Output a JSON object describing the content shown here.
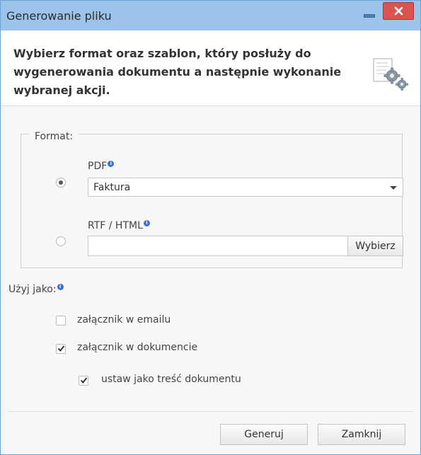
{
  "window": {
    "title": "Generowanie pliku"
  },
  "header": {
    "text": "Wybierz format oraz szablon, który posłuży do wygenerowania dokumentu a następnie wykonanie wybranej akcji."
  },
  "format": {
    "legend": "Format:",
    "pdf": {
      "label": "PDF",
      "selected": true,
      "template": "Faktura"
    },
    "rtf": {
      "label": "RTF / HTML",
      "selected": false,
      "file_value": "",
      "choose_label": "Wybierz"
    }
  },
  "use_as": {
    "label": "Użyj jako:",
    "options": [
      {
        "label": "załącznik w emailu",
        "checked": false
      },
      {
        "label": "załącznik w dokumencie",
        "checked": true
      },
      {
        "label": "ustaw jako treść dokumentu",
        "checked": true
      }
    ]
  },
  "footer": {
    "generate_label": "Generuj",
    "close_label": "Zamknij"
  },
  "icons": {
    "info": "info-icon",
    "settings": "document-gear-icon",
    "close": "close-icon",
    "minimize": "minimize-icon"
  },
  "colors": {
    "titlebar": "#9cc3e9",
    "close_button": "#d9534f",
    "info_badge": "#3b6fd4"
  }
}
